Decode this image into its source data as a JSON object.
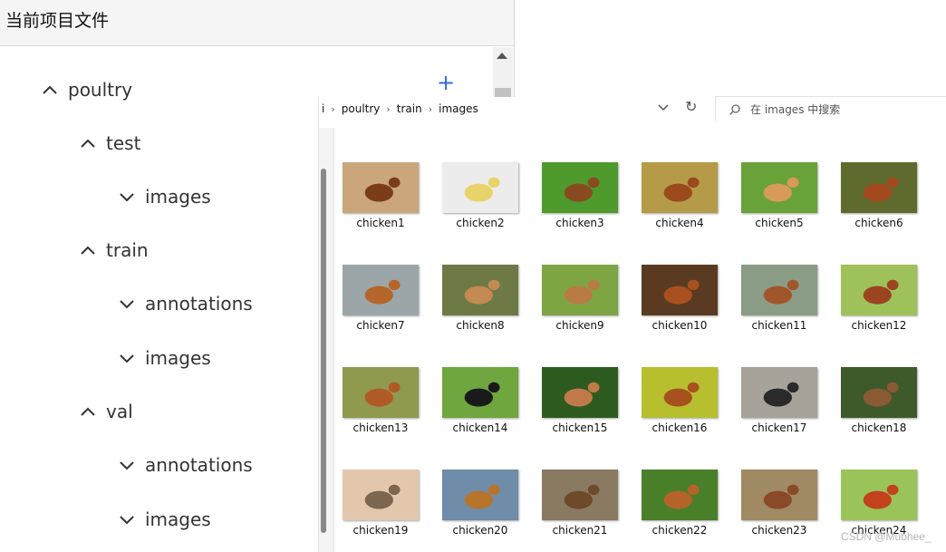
{
  "tree": {
    "title": "当前项目文件",
    "nodes": [
      {
        "label": "poultry",
        "state": "expanded"
      },
      {
        "label": "test",
        "state": "expanded"
      },
      {
        "label": "images",
        "state": "collapsed"
      },
      {
        "label": "train",
        "state": "expanded"
      },
      {
        "label": "annotations",
        "state": "collapsed"
      },
      {
        "label": "images",
        "state": "collapsed"
      },
      {
        "label": "val",
        "state": "expanded"
      },
      {
        "label": "annotations",
        "state": "collapsed"
      },
      {
        "label": "images",
        "state": "collapsed"
      }
    ],
    "add_icon": "+"
  },
  "explorer": {
    "breadcrumb": [
      "i",
      "poultry",
      "train",
      "images"
    ],
    "search_placeholder": "在 images 中搜索",
    "files": [
      {
        "name": "chicken1",
        "colors": [
          "#caa67a",
          "#7a3d18"
        ]
      },
      {
        "name": "chicken2",
        "colors": [
          "#ececec",
          "#e8d36b"
        ]
      },
      {
        "name": "chicken3",
        "colors": [
          "#4f9a2d",
          "#8a4a1f"
        ]
      },
      {
        "name": "chicken4",
        "colors": [
          "#b59a48",
          "#9a4a1c"
        ]
      },
      {
        "name": "chicken5",
        "colors": [
          "#6aa23a",
          "#d89a5a"
        ]
      },
      {
        "name": "chicken6",
        "colors": [
          "#5f6b2c",
          "#a4491d"
        ]
      },
      {
        "name": "chicken7",
        "colors": [
          "#9ca6a8",
          "#b5662a"
        ]
      },
      {
        "name": "chicken8",
        "colors": [
          "#6d7a45",
          "#c48a52"
        ]
      },
      {
        "name": "chicken9",
        "colors": [
          "#7da544",
          "#b87b43"
        ]
      },
      {
        "name": "chicken10",
        "colors": [
          "#5a3b21",
          "#a9501f"
        ]
      },
      {
        "name": "chicken11",
        "colors": [
          "#8b9c86",
          "#a0562a"
        ]
      },
      {
        "name": "chicken12",
        "colors": [
          "#9fc15a",
          "#9a4520"
        ]
      },
      {
        "name": "chicken13",
        "colors": [
          "#8f9a4f",
          "#b05a25"
        ]
      },
      {
        "name": "chicken14",
        "colors": [
          "#6fa63f",
          "#1a1a1a"
        ]
      },
      {
        "name": "chicken15",
        "colors": [
          "#2d5b1f",
          "#c07a4a"
        ]
      },
      {
        "name": "chicken16",
        "colors": [
          "#b7bf2f",
          "#a7521c"
        ]
      },
      {
        "name": "chicken17",
        "colors": [
          "#a7a39a",
          "#2a2a2a"
        ]
      },
      {
        "name": "chicken18",
        "colors": [
          "#3e5a2a",
          "#8a5a35"
        ]
      },
      {
        "name": "chicken19",
        "colors": [
          "#e3c7ad",
          "#7c6650"
        ]
      },
      {
        "name": "chicken20",
        "colors": [
          "#6f8ca8",
          "#b8742a"
        ]
      },
      {
        "name": "chicken21",
        "colors": [
          "#8a7a62",
          "#6e4a2a"
        ]
      },
      {
        "name": "chicken22",
        "colors": [
          "#4a7f2a",
          "#b5632a"
        ]
      },
      {
        "name": "chicken23",
        "colors": [
          "#a08a63",
          "#8a4a2a"
        ]
      },
      {
        "name": "chicken24",
        "colors": [
          "#9ac45a",
          "#c2421c"
        ]
      }
    ]
  },
  "watermark": "CSDN @Mubhee_",
  "accent": "#2f6bd8"
}
